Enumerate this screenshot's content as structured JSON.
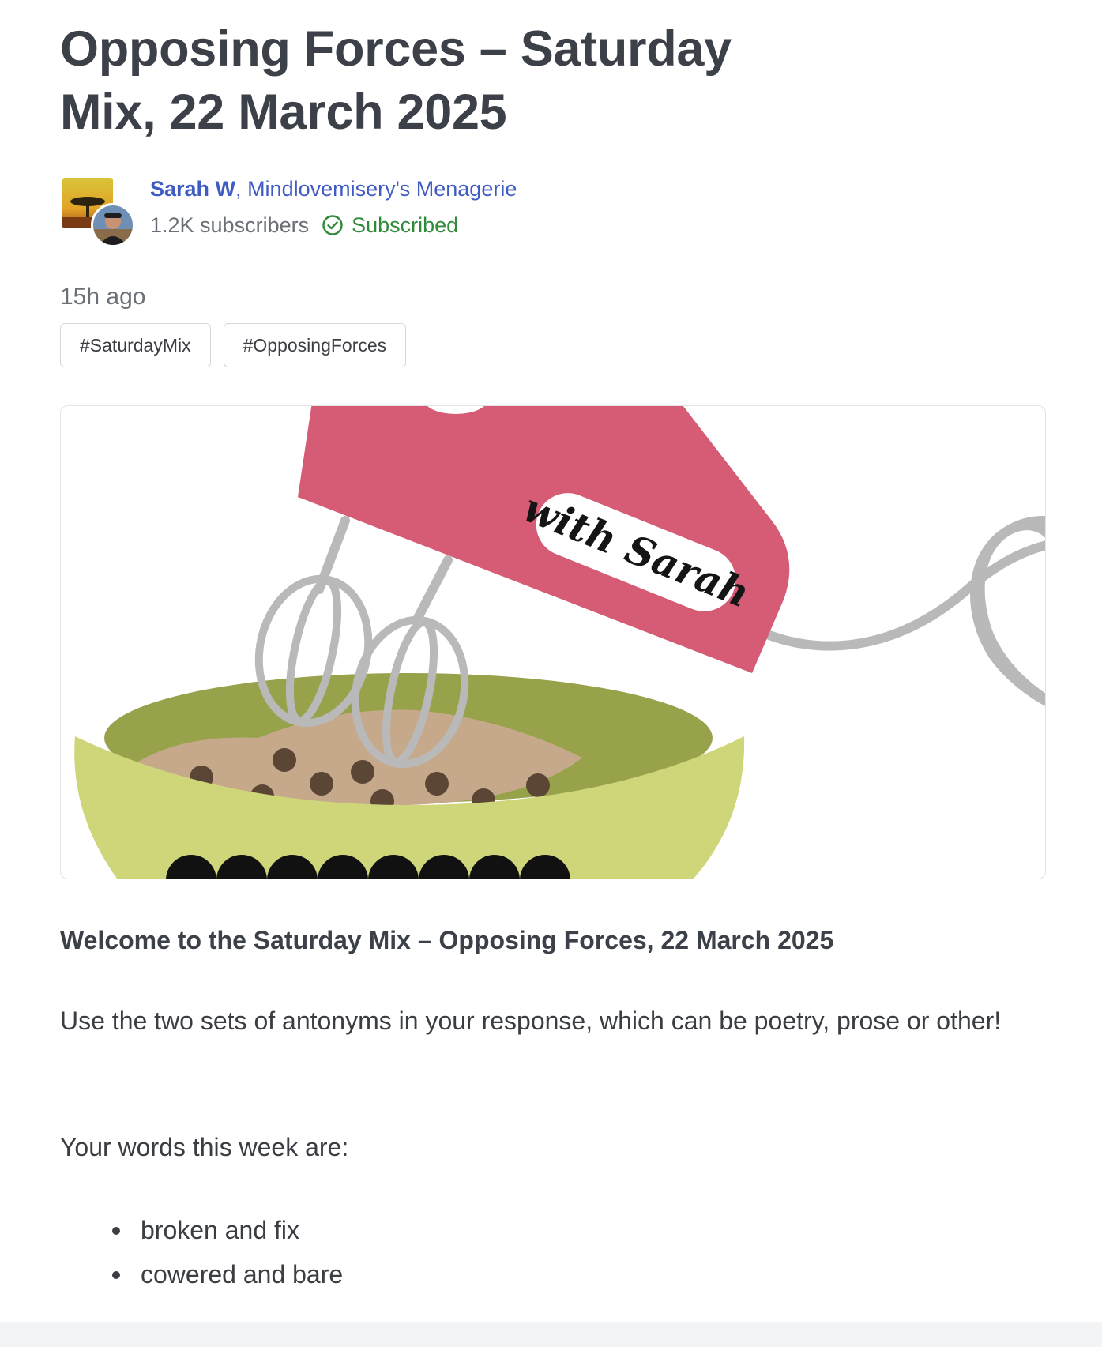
{
  "post": {
    "title": "Opposing Forces – Saturday Mix, 22 March 2025",
    "timestamp": "15h ago"
  },
  "byline": {
    "author_name": "Sarah W",
    "separator": ",",
    "publication_name": "Mindlovemisery's Menagerie",
    "subscriber_count": "1.2K subscribers",
    "subscription_status": "Subscribed",
    "status_icon": "check-circle-icon"
  },
  "tags": [
    "#SaturdayMix",
    "#OpposingForces"
  ],
  "hero_image": {
    "caption_text": "with Sarah"
  },
  "content": {
    "lead": "Welcome to the Saturday Mix – Opposing Forces, 22 March 2025",
    "paragraph1": "Use the two sets of antonyms in your response, which can be poetry, prose or other!",
    "paragraph2": "Your words this week are:",
    "words": [
      "broken and fix",
      "cowered and bare"
    ]
  },
  "colors": {
    "link": "#3f5bc4",
    "subscribed": "#2f8a3a",
    "mixer_pink": "#d65b74",
    "bowl_outer": "#cfd67a",
    "bowl_inner": "#98a24a",
    "batter": "#c5a98a"
  }
}
